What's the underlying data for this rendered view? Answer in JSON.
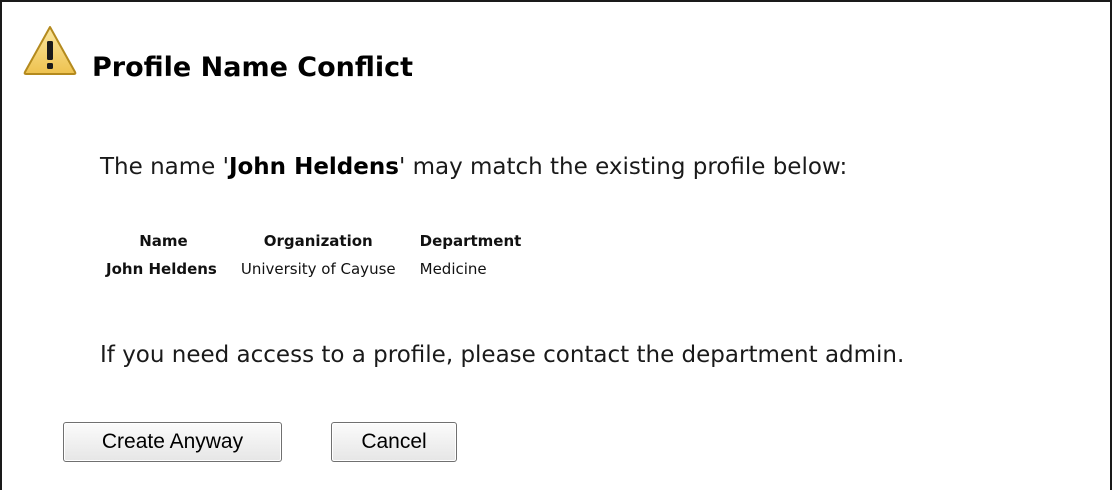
{
  "dialog": {
    "title": "Profile Name Conflict",
    "message": {
      "prefix": "The name '",
      "name": "John Heldens",
      "suffix": "' may match the existing profile below:"
    },
    "table": {
      "headers": [
        "Name",
        "Organization",
        "Department"
      ],
      "rows": [
        [
          "John Heldens",
          "University of Cayuse",
          "Medicine"
        ]
      ]
    },
    "footer_text": "If you need access to a profile, please contact the department admin.",
    "buttons": {
      "create": "Create Anyway",
      "cancel": "Cancel"
    },
    "icon": "warning-icon",
    "colors": {
      "warning_fill": "#f6d46a",
      "warning_stroke": "#c9a227",
      "border": "#1a1a1a"
    }
  }
}
